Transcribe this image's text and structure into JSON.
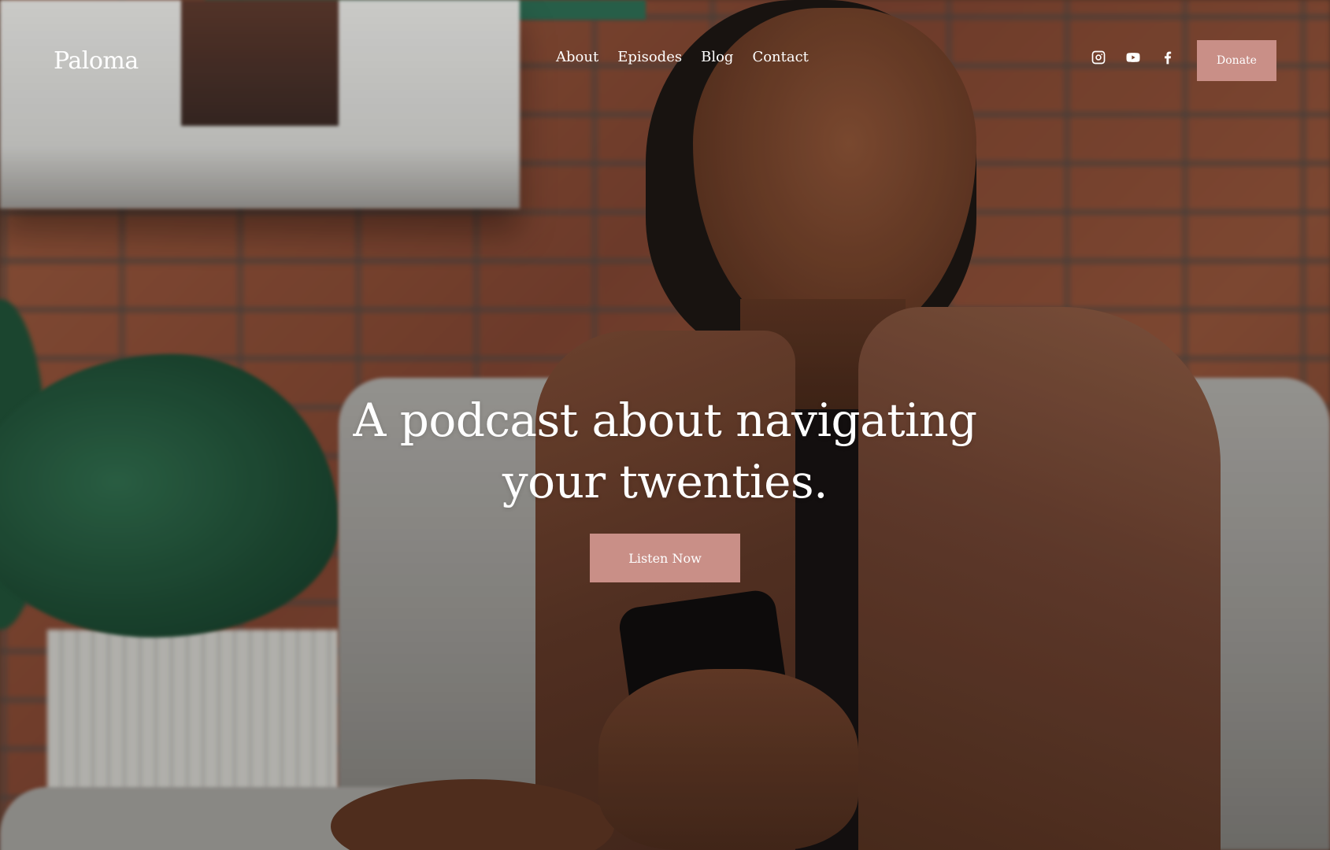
{
  "header": {
    "logo": "Paloma",
    "nav": [
      {
        "label": "About"
      },
      {
        "label": "Episodes"
      },
      {
        "label": "Blog"
      },
      {
        "label": "Contact"
      }
    ],
    "socials": [
      {
        "icon": "instagram-icon"
      },
      {
        "icon": "youtube-icon"
      },
      {
        "icon": "facebook-icon"
      }
    ],
    "donate_label": "Donate"
  },
  "hero": {
    "title_line1": "A podcast about navigating",
    "title_line2": "your twenties.",
    "cta_label": "Listen Now"
  },
  "colors": {
    "accent": "#c98f87",
    "text": "#ffffff"
  }
}
